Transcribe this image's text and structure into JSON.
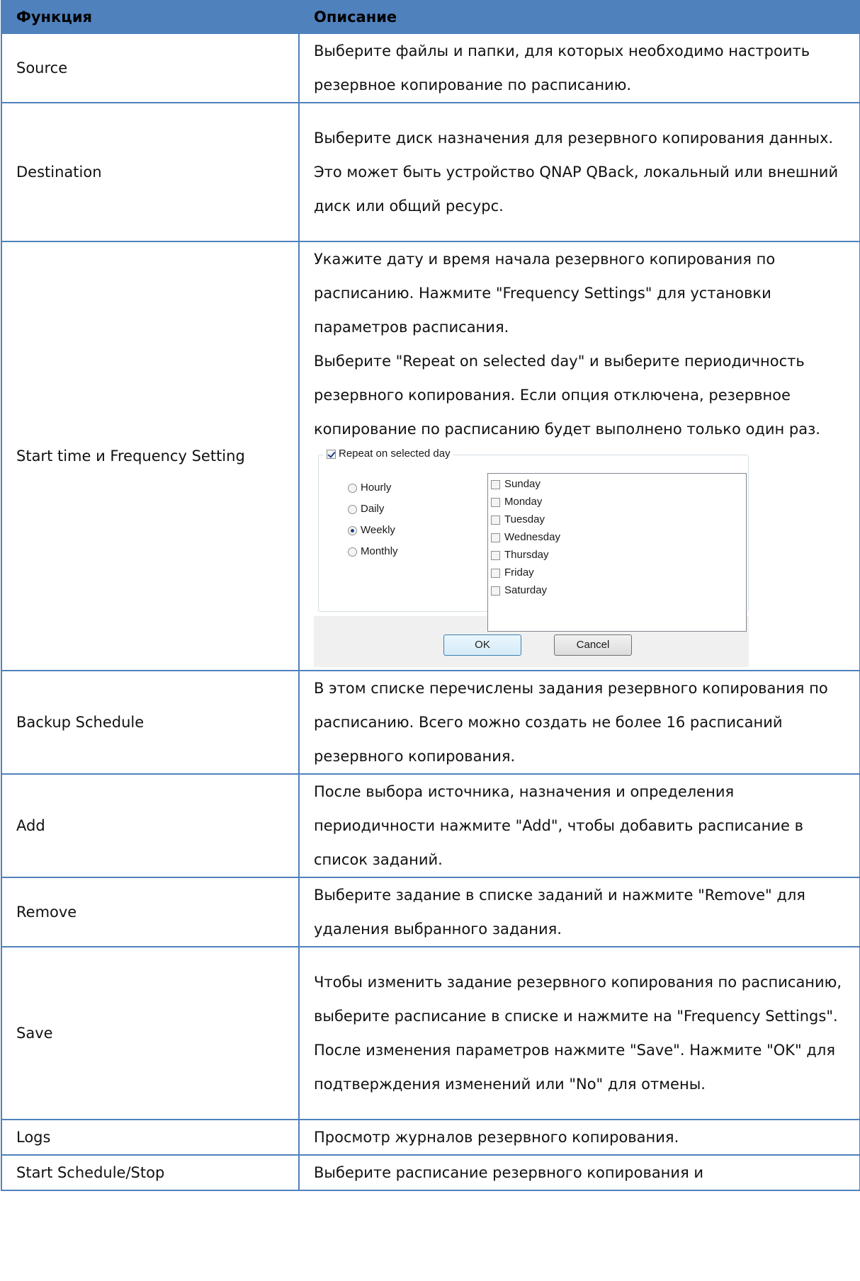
{
  "header": {
    "col1": "Функция",
    "col2": "Описание"
  },
  "rows": [
    {
      "function": "Source",
      "description": [
        "Выберите файлы и папки, для которых необходимо настроить резервное копирование по расписанию."
      ]
    },
    {
      "function": "Destination",
      "description": [
        "Выберите диск назначения для резервного копирования данных. Это может быть устройство QNAP QBack, локальный или внешний диск или общий ресурс."
      ]
    },
    {
      "function": "Start time и Frequency Setting",
      "description": [
        "Укажите дату и время начала резервного копирования по расписанию. Нажмите \"Frequency Settings\" для установки параметров расписания.",
        "Выберите \"Repeat on selected day\" и выберите периодичность резервного копирования. Если опция отключена, резервное копирование по расписанию будет выполнено только один раз."
      ]
    },
    {
      "function": "Backup Schedule",
      "description": [
        "В этом списке перечислены задания резервного копирования по расписанию. Всего можно создать не более 16 расписаний резервного копирования."
      ]
    },
    {
      "function": "Add",
      "description": [
        "После выбора источника, назначения и определения периодичности нажмите \"Add\", чтобы добавить расписание в список заданий."
      ]
    },
    {
      "function": "Remove",
      "description": [
        "Выберите задание в списке заданий и нажмите \"Remove\" для удаления выбранного задания."
      ]
    },
    {
      "function": "Save",
      "description": [
        "Чтобы изменить задание резервного копирования по расписанию, выберите расписание в списке и нажмите на \"Frequency Settings\". После изменения параметров нажмите \"Save\". Нажмите \"OK\" для подтверждения изменений или \"No\" для отмены."
      ]
    },
    {
      "function": "Logs",
      "description": [
        "Просмотр журналов резервного копирования."
      ]
    },
    {
      "function": "Start Schedule/Stop",
      "description": [
        "Выберите расписание резервного копирования и"
      ]
    }
  ],
  "dialog": {
    "repeat_label": "Repeat on selected day",
    "repeat_checked": true,
    "frequencies": [
      {
        "label": "Hourly",
        "selected": false
      },
      {
        "label": "Daily",
        "selected": false
      },
      {
        "label": "Weekly",
        "selected": true
      },
      {
        "label": "Monthly",
        "selected": false
      }
    ],
    "days": [
      {
        "label": "Sunday",
        "checked": false
      },
      {
        "label": "Monday",
        "checked": false
      },
      {
        "label": "Tuesday",
        "checked": false
      },
      {
        "label": "Wednesday",
        "checked": false
      },
      {
        "label": "Thursday",
        "checked": false
      },
      {
        "label": "Friday",
        "checked": false
      },
      {
        "label": "Saturday",
        "checked": false
      }
    ],
    "ok_label": "OK",
    "cancel_label": "Cancel"
  },
  "colors": {
    "header_bg": "#4f81bd",
    "border": "#4f81bd"
  }
}
